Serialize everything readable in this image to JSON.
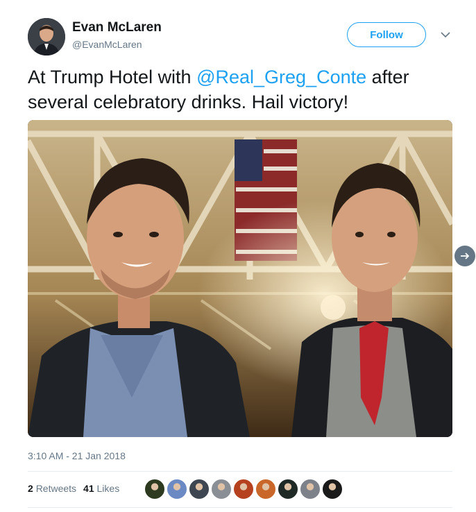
{
  "author": {
    "display_name": "Evan McLaren",
    "handle": "@EvanMcLaren",
    "avatar_icon": "user-avatar"
  },
  "follow_label": "Follow",
  "tweet": {
    "text_before": "At Trump Hotel with ",
    "mention": "@Real_Greg_Conte",
    "text_after": " after several celebratory drinks. Hail victory!"
  },
  "timestamp": "3:10 AM - 21 Jan 2018",
  "stats": {
    "retweets_count": "2",
    "retweets_label": "Retweets",
    "likes_count": "41",
    "likes_label": "Likes"
  },
  "likers": [
    {
      "color": "#2d3a1f"
    },
    {
      "color": "#6b8ac4"
    },
    {
      "color": "#3d4651"
    },
    {
      "color": "#8a8f96"
    },
    {
      "color": "#b5411f"
    },
    {
      "color": "#c9672a"
    },
    {
      "color": "#1f2a26"
    },
    {
      "color": "#7d8189"
    },
    {
      "color": "#1a1a1a"
    }
  ],
  "colors": {
    "accent": "#1da1f2",
    "text": "#14171a",
    "secondary": "#657786"
  }
}
